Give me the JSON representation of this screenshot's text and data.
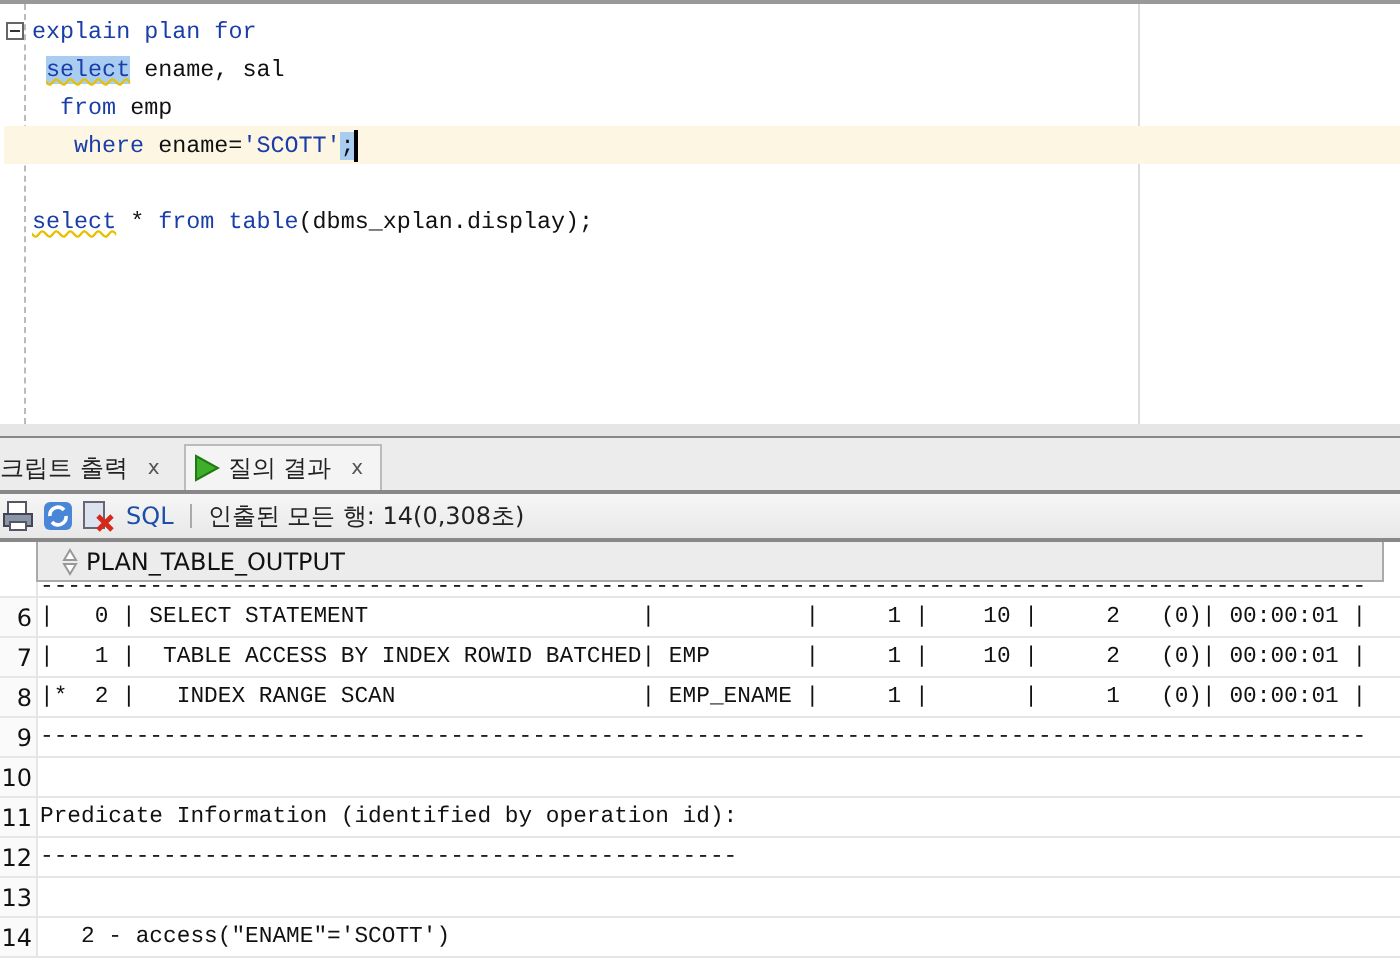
{
  "editor": {
    "lines": [
      {
        "kind": "code",
        "current": false,
        "foldable": true,
        "cursor": false,
        "tokens": [
          {
            "text": "explain plan for",
            "kind": "keyword",
            "highlighted": false,
            "warning": false
          }
        ],
        "children": [
          {
            "kind": "code",
            "current": false,
            "foldable": false,
            "cursor": false,
            "tokens": [
              {
                "text": "select",
                "kind": "keyword",
                "highlighted": true,
                "warning": true
              },
              {
                "text": " ename, sal",
                "kind": "text",
                "highlighted": false,
                "warning": false
              }
            ],
            "children": [
              {
                "kind": "code",
                "current": false,
                "foldable": false,
                "cursor": false,
                "tokens": [
                  {
                    "text": "from",
                    "kind": "keyword",
                    "highlighted": false,
                    "warning": false
                  },
                  {
                    "text": " emp",
                    "kind": "text",
                    "highlighted": false,
                    "warning": false
                  }
                ],
                "children": [
                  {
                    "kind": "code",
                    "current": true,
                    "foldable": false,
                    "cursor": true,
                    "tokens": [
                      {
                        "text": "where",
                        "kind": "keyword",
                        "highlighted": false,
                        "warning": false
                      },
                      {
                        "text": " ename=",
                        "kind": "text",
                        "highlighted": false,
                        "warning": false
                      },
                      {
                        "text": "'SCOTT'",
                        "kind": "string",
                        "highlighted": false,
                        "warning": false
                      },
                      {
                        "text": ";",
                        "kind": "text",
                        "highlighted": true,
                        "warning": false
                      }
                    ]
                  }
                ]
              }
            ]
          }
        ]
      },
      {
        "kind": "blank"
      },
      {
        "kind": "code",
        "current": false,
        "foldable": false,
        "cursor": false,
        "tokens": [
          {
            "text": "select",
            "kind": "keyword",
            "highlighted": false,
            "warning": true
          },
          {
            "text": " * ",
            "kind": "text",
            "highlighted": false,
            "warning": false
          },
          {
            "text": "from table",
            "kind": "keyword",
            "highlighted": false,
            "warning": false
          },
          {
            "text": "(dbms_xplan.display);",
            "kind": "text",
            "highlighted": false,
            "warning": false
          }
        ]
      }
    ]
  },
  "tabs": [
    {
      "label": "크립트 출력",
      "close": "x",
      "selected": false,
      "kind": "plain"
    },
    {
      "label": "질의 결과",
      "close": "x",
      "selected": true,
      "kind": "run"
    }
  ],
  "toolbar": {
    "sql": "SQL",
    "status": "인출된 모든 행: 14(0,308초)"
  },
  "grid": {
    "column": "PLAN_TABLE_OUTPUT",
    "partial_row": "-------------------------------------------------------------------------------------------------",
    "rows": [
      {
        "number": "6",
        "text": "|   0 | SELECT STATEMENT                    |           |     1 |    10 |     2   (0)| 00:00:01 |"
      },
      {
        "number": "7",
        "text": "|   1 |  TABLE ACCESS BY INDEX ROWID BATCHED| EMP       |     1 |    10 |     2   (0)| 00:00:01 |"
      },
      {
        "number": "8",
        "text": "|*  2 |   INDEX RANGE SCAN                  | EMP_ENAME |     1 |       |     1   (0)| 00:00:01 |"
      },
      {
        "number": "9",
        "text": "-------------------------------------------------------------------------------------------------"
      },
      {
        "number": "10",
        "text": ""
      },
      {
        "number": "11",
        "text": "Predicate Information (identified by operation id):"
      },
      {
        "number": "12",
        "text": "---------------------------------------------------"
      },
      {
        "number": "13",
        "text": ""
      },
      {
        "number": "14",
        "text": "   2 - access(\"ENAME\"='SCOTT')"
      }
    ]
  }
}
